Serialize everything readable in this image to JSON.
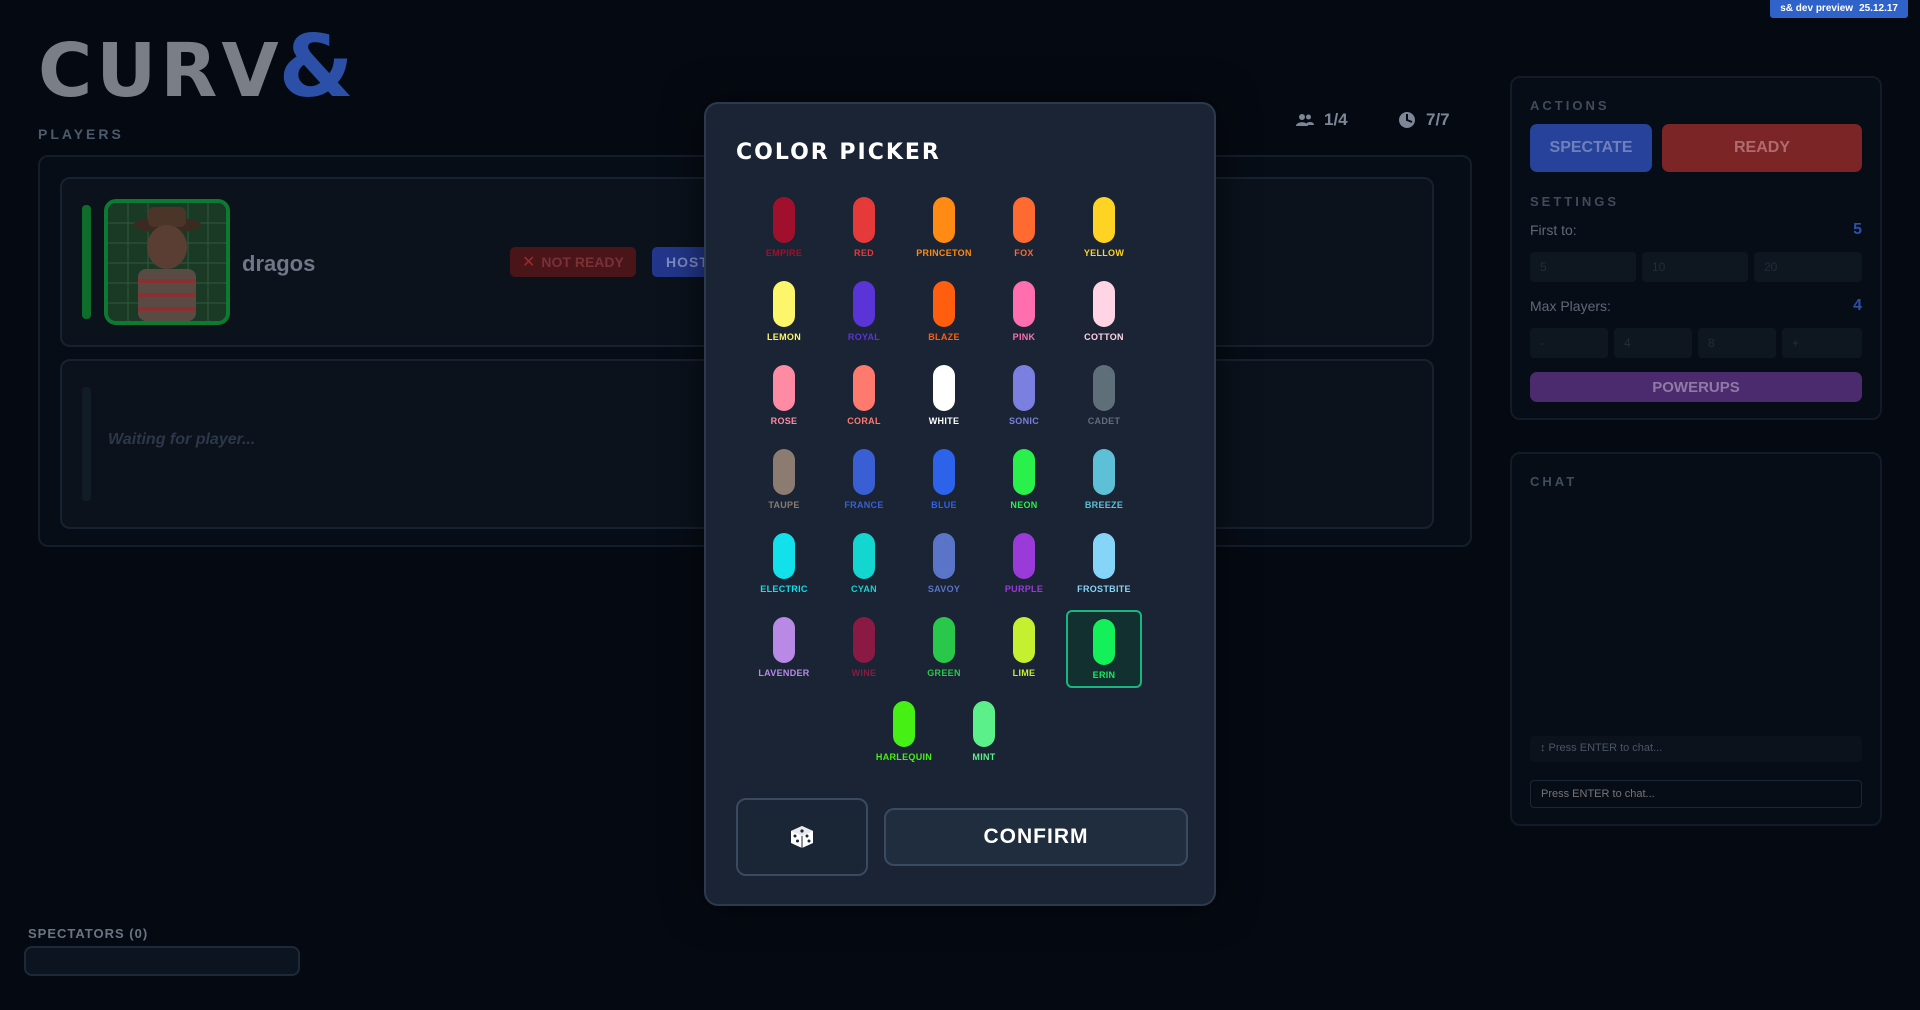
{
  "badge": {
    "label": "s& dev preview",
    "version": "25.12.17"
  },
  "logo": {
    "main": "CURV",
    "amp": "&"
  },
  "players": {
    "label": "PLAYERS",
    "list": [
      {
        "name": "dragos",
        "status": "NOT READY",
        "role": "HOST"
      }
    ],
    "waiting_text": "Waiting for player..."
  },
  "stats": {
    "players": "1/4",
    "rounds": "7/7"
  },
  "actions": {
    "label": "ACTIONS",
    "spectate": "SPECTATE",
    "ready": "READY"
  },
  "settings": {
    "label": "SETTINGS",
    "first_to_label": "First to:",
    "first_to_value": "5",
    "first_to_options": [
      "5",
      "10",
      "20"
    ],
    "max_players_label": "Max Players:",
    "max_players_value": "4",
    "max_players_options": [
      "-",
      "4",
      "8",
      "+"
    ],
    "powerups": "POWERUPS"
  },
  "chat": {
    "label": "CHAT",
    "hint": "↕ Press ENTER to chat...",
    "placeholder": "Press ENTER to chat..."
  },
  "spectators": {
    "label": "SPECTATORS (0)"
  },
  "color_picker": {
    "title": "COLOR PICKER",
    "confirm": "CONFIRM",
    "selected": "ERIN",
    "colors": [
      {
        "name": "EMPIRE",
        "hex": "#a0102c"
      },
      {
        "name": "RED",
        "hex": "#e63a3a"
      },
      {
        "name": "PRINCETON",
        "hex": "#ff8a14"
      },
      {
        "name": "FOX",
        "hex": "#ff6a30"
      },
      {
        "name": "YELLOW",
        "hex": "#ffd324"
      },
      {
        "name": "LEMON",
        "hex": "#fdf56a"
      },
      {
        "name": "ROYAL",
        "hex": "#5a34d6"
      },
      {
        "name": "BLAZE",
        "hex": "#ff5e0e"
      },
      {
        "name": "PINK",
        "hex": "#ff6fb0"
      },
      {
        "name": "COTTON",
        "hex": "#ffd4e4"
      },
      {
        "name": "ROSE",
        "hex": "#ff8aa4"
      },
      {
        "name": "CORAL",
        "hex": "#ff7a6e"
      },
      {
        "name": "WHITE",
        "hex": "#ffffff"
      },
      {
        "name": "SONIC",
        "hex": "#7b80e0"
      },
      {
        "name": "CADET",
        "hex": "#5f6f7a"
      },
      {
        "name": "TAUPE",
        "hex": "#8b7b70"
      },
      {
        "name": "FRANCE",
        "hex": "#3a5fd4"
      },
      {
        "name": "BLUE",
        "hex": "#2d62ea"
      },
      {
        "name": "NEON",
        "hex": "#29f04a"
      },
      {
        "name": "BREEZE",
        "hex": "#5ec0d6"
      },
      {
        "name": "ELECTRIC",
        "hex": "#12e0ea"
      },
      {
        "name": "CYAN",
        "hex": "#14d6d0"
      },
      {
        "name": "SAVOY",
        "hex": "#5a74c8"
      },
      {
        "name": "PURPLE",
        "hex": "#9a3ad8"
      },
      {
        "name": "FROSTBITE",
        "hex": "#86d4f8"
      },
      {
        "name": "LAVENDER",
        "hex": "#b88ae6"
      },
      {
        "name": "WINE",
        "hex": "#8a1a44"
      },
      {
        "name": "GREEN",
        "hex": "#2ac84a"
      },
      {
        "name": "LIME",
        "hex": "#c4f030"
      },
      {
        "name": "ERIN",
        "hex": "#14f05a"
      },
      {
        "name": "HARLEQUIN",
        "hex": "#46f014"
      },
      {
        "name": "MINT",
        "hex": "#5cf08a"
      }
    ]
  }
}
